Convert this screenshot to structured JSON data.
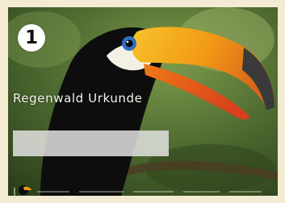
{
  "certificate": {
    "badge_number": "1",
    "title": "Regenwald Urkunde",
    "subtitle": "",
    "name_field": ""
  },
  "colors": {
    "foliage": "#3b5525",
    "bill_orange": "#f39a16",
    "bill_red": "#e5541c",
    "bill_tip": "#3a3a3a",
    "plumage": "#0d0d0d",
    "throat": "#f4f1e4",
    "eye_ring": "#2f6fc4",
    "frame": "#f3ecd2"
  },
  "icons": {
    "badge": "number-badge-icon",
    "toucan": "toucan-photo",
    "logo": "toucan-logo-icon"
  }
}
